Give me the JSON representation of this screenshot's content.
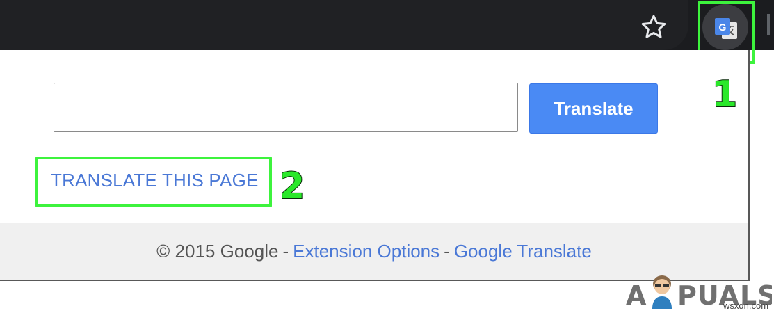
{
  "toolbar": {
    "bookmark_icon": "star-outline-icon",
    "extension_icon": "google-translate-icon"
  },
  "popup": {
    "input_value": "",
    "input_placeholder": "",
    "translate_button": "Translate",
    "translate_page_link": "TRANSLATE THIS PAGE",
    "footer": {
      "copyright": "© 2015 Google",
      "separator": "-",
      "extension_options": "Extension Options",
      "google_translate": "Google Translate"
    }
  },
  "annotations": {
    "step1": "1",
    "step2": "2",
    "highlight_color": "#3df33d"
  },
  "branding": {
    "logo": "APPUALS",
    "watermark": "wsxdn.com"
  }
}
